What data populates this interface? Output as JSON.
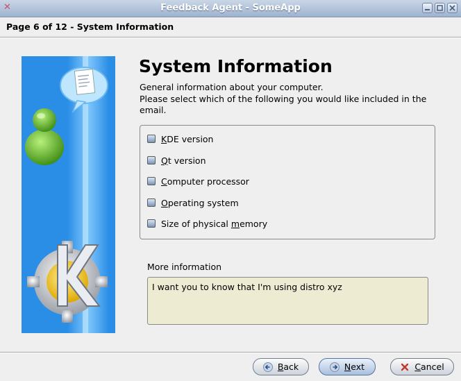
{
  "window": {
    "title": "Feedback Agent - SomeApp"
  },
  "page_header": "Page 6 of 12 - System Information",
  "main": {
    "heading": "System Information",
    "description_line1": "General information about your computer.",
    "description_line2": "Please select which of the following you would like included in the email.",
    "checkboxes": [
      {
        "label": "KDE version",
        "mnemonic": "K",
        "checked": false
      },
      {
        "label": "Qt version",
        "mnemonic": "Q",
        "checked": false
      },
      {
        "label": "Computer processor",
        "mnemonic": "C",
        "checked": false
      },
      {
        "label": "Operating system",
        "mnemonic": "O",
        "checked": false
      },
      {
        "label": "Size of physical memory",
        "mnemonic": "m",
        "checked": false
      }
    ],
    "more_info_label": "More information",
    "more_info_value": "I want you to know that I'm using distro xyz"
  },
  "buttons": {
    "back": "Back",
    "next": "Next",
    "cancel": "Cancel"
  },
  "colors": {
    "sidebar": "#2a8ee6",
    "titlebar": "#9fb3cf",
    "textarea_bg": "#eeebd3"
  }
}
